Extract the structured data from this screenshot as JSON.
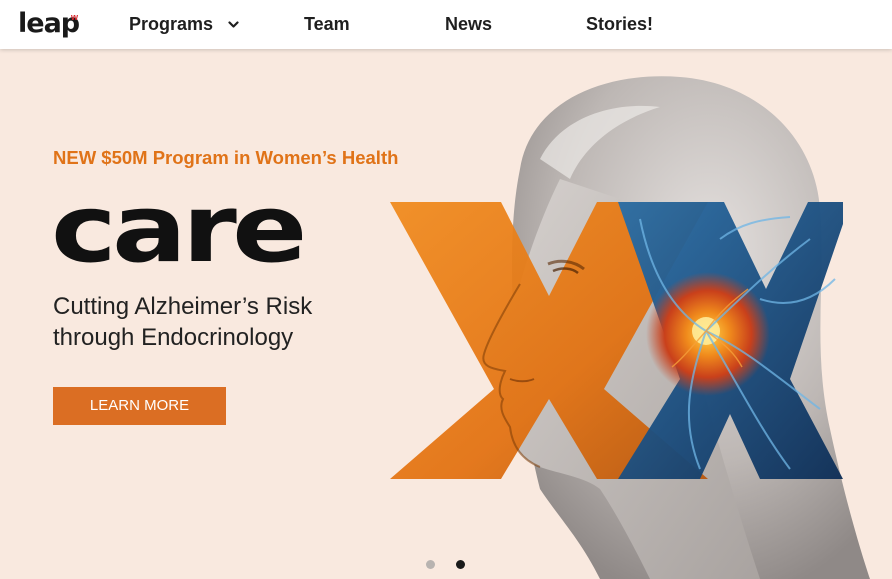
{
  "nav": {
    "logo_text": "leap",
    "logo_mark": "w",
    "items": [
      {
        "label": "Programs",
        "has_dropdown": true
      },
      {
        "label": "Team"
      },
      {
        "label": "News"
      },
      {
        "label": "Stories!"
      }
    ]
  },
  "hero": {
    "tagline": "NEW $50M Program in Women’s Health",
    "title": "care",
    "subtitle": "Cutting Alzheimer’s Risk through Endocrinology",
    "button_label": "LEARN MORE",
    "image_icon": "woman-profile-neuron-x-graphic"
  },
  "carousel": {
    "slide_count": 2,
    "active_slide": 2
  },
  "colors": {
    "accent_orange": "#db6e23",
    "tagline_orange": "#e07318",
    "background": "#f9e9df",
    "neuron_blue": "#1d4f86",
    "logo_red": "#d8232a"
  }
}
